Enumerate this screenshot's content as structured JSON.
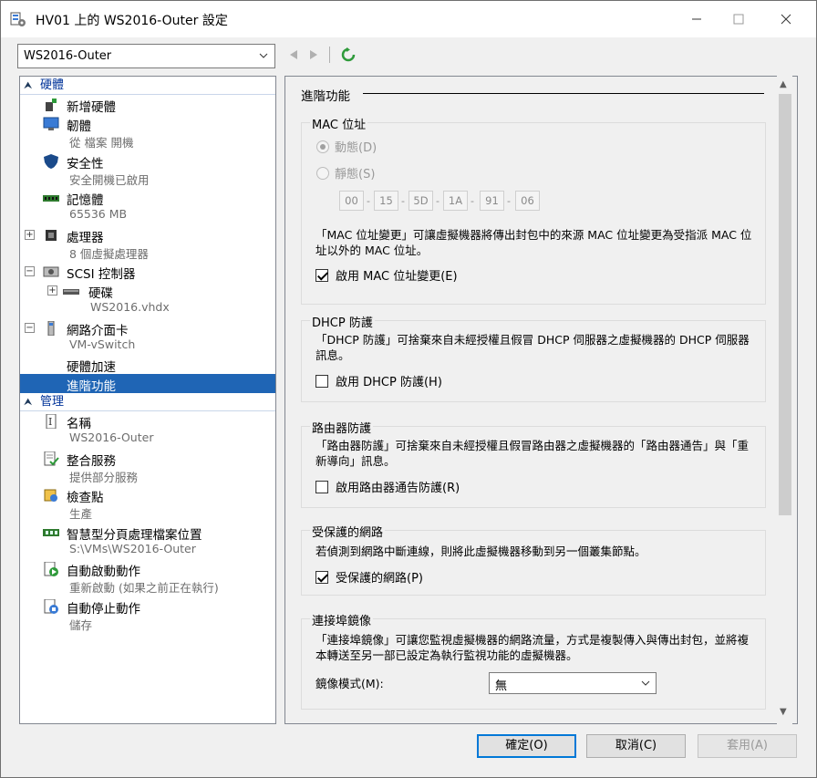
{
  "window": {
    "title": "HV01 上的 WS2016-Outer 設定",
    "controls": {
      "minimize": "—",
      "maximize": "☐",
      "close": "✕"
    }
  },
  "vm_selector": {
    "value": "WS2016-Outer"
  },
  "tree": {
    "hardware_header": "硬體",
    "hardware_items": [
      {
        "label": "新增硬體",
        "sub": "",
        "icon": "add-hardware-icon"
      },
      {
        "label": "韌體",
        "sub": "從 檔案 開機",
        "icon": "firmware-icon"
      },
      {
        "label": "安全性",
        "sub": "安全開機已啟用",
        "icon": "shield-icon"
      },
      {
        "label": "記憶體",
        "sub": "65536 MB",
        "icon": "memory-icon"
      },
      {
        "label": "處理器",
        "sub": "8 個虛擬處理器",
        "icon": "processor-icon"
      },
      {
        "label": "SCSI 控制器",
        "sub": "",
        "icon": "scsi-controller-icon"
      },
      {
        "label": "硬碟",
        "sub": "WS2016.vhdx",
        "icon": "hard-drive-icon"
      },
      {
        "label": "網路介面卡",
        "sub": "VM-vSwitch",
        "icon": "network-adapter-icon"
      },
      {
        "label": "硬體加速",
        "sub": ""
      },
      {
        "label": "進階功能",
        "sub": ""
      }
    ],
    "management_header": "管理",
    "management_items": [
      {
        "label": "名稱",
        "sub": "WS2016-Outer",
        "icon": "name-icon"
      },
      {
        "label": "整合服務",
        "sub": "提供部分服務",
        "icon": "integration-services-icon"
      },
      {
        "label": "檢查點",
        "sub": "生產",
        "icon": "checkpoint-icon"
      },
      {
        "label": "智慧型分頁處理檔案位置",
        "sub": "S:\\VMs\\WS2016-Outer",
        "icon": "paging-file-icon"
      },
      {
        "label": "自動啟動動作",
        "sub": "重新啟動 (如果之前正在執行)",
        "icon": "auto-start-icon"
      },
      {
        "label": "自動停止動作",
        "sub": "儲存",
        "icon": "auto-stop-icon"
      }
    ]
  },
  "page": {
    "title": "進階功能",
    "mac": {
      "group_title": "MAC 位址",
      "dynamic_label": "動態(D)",
      "static_label": "靜態(S)",
      "octets": [
        "00",
        "15",
        "5D",
        "1A",
        "91",
        "06"
      ],
      "description": "「MAC 位址變更」可讓虛擬機器將傳出封包中的來源 MAC 位址變更為受指派 MAC 位址以外的 MAC 位址。",
      "checkbox_label": "啟用 MAC 位址變更(E)"
    },
    "dhcp": {
      "group_title": "DHCP 防護",
      "description": "「DHCP 防護」可捨棄來自未經授權且假冒 DHCP 伺服器之虛擬機器的 DHCP 伺服器訊息。",
      "checkbox_label": "啟用 DHCP 防護(H)"
    },
    "router": {
      "group_title": "路由器防護",
      "description": "「路由器防護」可捨棄來自未經授權且假冒路由器之虛擬機器的「路由器通告」與「重新導向」訊息。",
      "checkbox_label": "啟用路由器通告防護(R)"
    },
    "protected": {
      "group_title": "受保護的網路",
      "description": "若偵測到網路中斷連線，則將此虛擬機器移動到另一個叢集節點。",
      "checkbox_label": "受保護的網路(P)"
    },
    "mirror": {
      "group_title": "連接埠鏡像",
      "description": "「連接埠鏡像」可讓您監視虛擬機器的網路流量，方式是複製傳入與傳出封包，並將複本轉送至另一部已設定為執行監視功能的虛擬機器。",
      "mode_label": "鏡像模式(M):",
      "mode_value": "無"
    }
  },
  "buttons": {
    "ok": "確定(O)",
    "cancel": "取消(C)",
    "apply": "套用(A)"
  },
  "colors": {
    "selection": "#1f65b5",
    "accent": "#0078d7",
    "header": "#003399",
    "refresh": "#2e9a3a"
  }
}
